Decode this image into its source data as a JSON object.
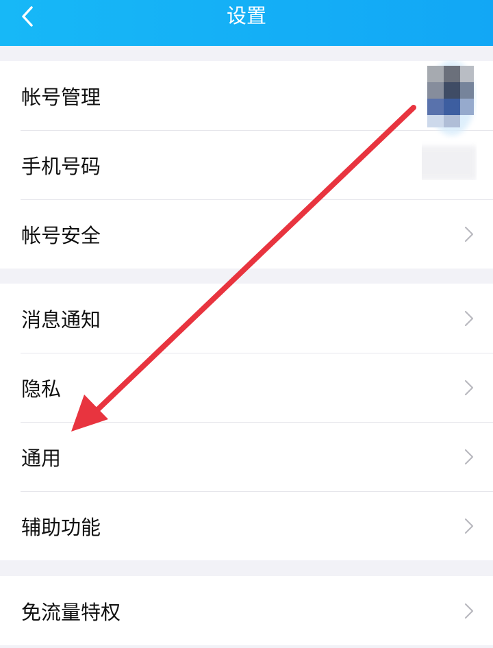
{
  "header": {
    "title": "设置",
    "back_icon": "chevron-left-icon"
  },
  "groups": [
    {
      "items": [
        {
          "label": "帐号管理",
          "has_chevron": false
        },
        {
          "label": "手机号码",
          "has_chevron": false
        },
        {
          "label": "帐号安全",
          "has_chevron": true
        }
      ]
    },
    {
      "items": [
        {
          "label": "消息通知",
          "has_chevron": true
        },
        {
          "label": "隐私",
          "has_chevron": true
        },
        {
          "label": "通用",
          "has_chevron": true
        },
        {
          "label": "辅助功能",
          "has_chevron": true
        }
      ]
    },
    {
      "items": [
        {
          "label": "免流量特权",
          "has_chevron": true
        }
      ]
    }
  ],
  "colors": {
    "header_start": "#17b8f7",
    "header_end": "#12a7f5",
    "background": "#f2f2f7",
    "annotation_arrow": "#e8343f"
  }
}
